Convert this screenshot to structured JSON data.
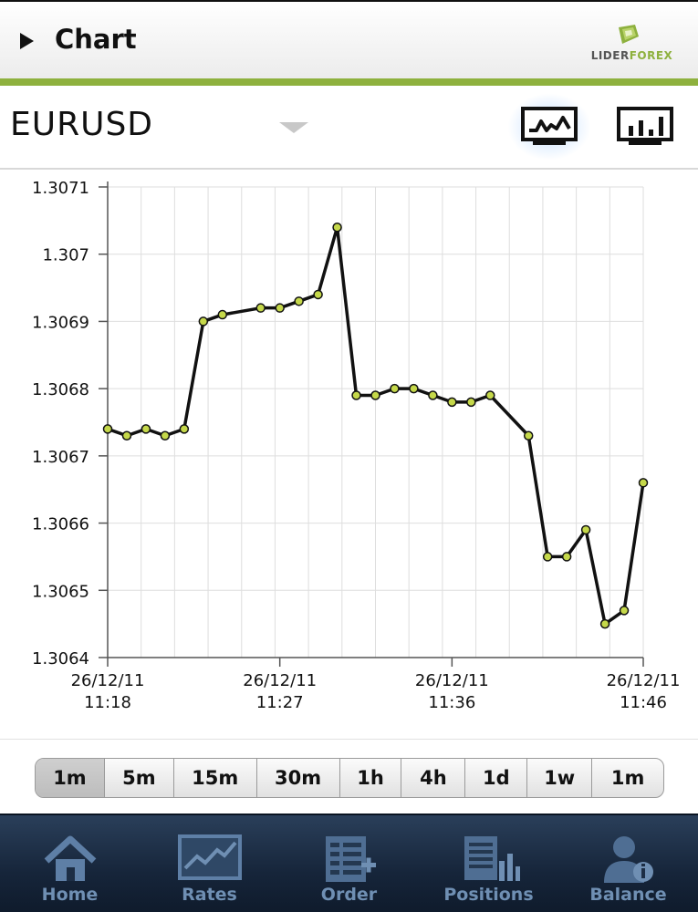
{
  "header": {
    "title": "Chart",
    "logo_part1": "LIDER",
    "logo_part2": "FOREX"
  },
  "symbol": {
    "name": "EURUSD",
    "views": [
      "line-chart-icon",
      "bar-chart-icon"
    ],
    "selected_view": "line"
  },
  "timeframes": {
    "items": [
      "1m",
      "5m",
      "15m",
      "30m",
      "1h",
      "4h",
      "1d",
      "1w",
      "1m"
    ],
    "selected_index": 0
  },
  "nav": {
    "items": [
      {
        "label": "Home",
        "icon": "home-icon"
      },
      {
        "label": "Rates",
        "icon": "rates-icon"
      },
      {
        "label": "Order",
        "icon": "order-icon"
      },
      {
        "label": "Positions",
        "icon": "positions-icon"
      },
      {
        "label": "Balance",
        "icon": "balance-icon"
      }
    ]
  },
  "colors": {
    "accent": "#8eb13e",
    "marker": "#c5d84a",
    "line": "#111111",
    "nav_label": "#6f8fb3"
  },
  "chart_data": {
    "type": "line",
    "x": [
      "11:18",
      "11:19",
      "11:20",
      "11:21",
      "11:22",
      "11:23",
      "11:24",
      "11:25",
      "11:26",
      "11:27",
      "11:28",
      "11:29",
      "11:30",
      "11:31",
      "11:32",
      "11:33",
      "11:34",
      "11:35",
      "11:36",
      "11:37",
      "11:38",
      "11:39",
      "11:40",
      "11:41",
      "11:42",
      "11:43",
      "11:44",
      "11:45",
      "11:46"
    ],
    "values": [
      1.30674,
      1.30673,
      1.30674,
      1.30673,
      1.30674,
      1.3069,
      1.30691,
      1.30692,
      1.30692,
      1.30693,
      1.30694,
      1.30704,
      1.30679,
      1.30679,
      1.3068,
      1.3068,
      1.30679,
      1.30678,
      1.30678,
      1.30679,
      1.30673,
      1.30655,
      1.30655,
      1.30659,
      1.30645,
      1.30647,
      1.30666
    ],
    "x_tick_labels": [
      {
        "date": "26/12/11",
        "time": "11:18"
      },
      {
        "date": "26/12/11",
        "time": "11:27"
      },
      {
        "date": "26/12/11",
        "time": "11:36"
      },
      {
        "date": "26/12/11",
        "time": "11:46"
      }
    ],
    "y_tick_labels": [
      "1.3071",
      "1.307",
      "1.3069",
      "1.3068",
      "1.3067",
      "1.3066",
      "1.3065",
      "1.3064"
    ],
    "ylim": [
      1.3064,
      1.3071
    ],
    "grid": true,
    "title": "",
    "xlabel": "",
    "ylabel": ""
  }
}
